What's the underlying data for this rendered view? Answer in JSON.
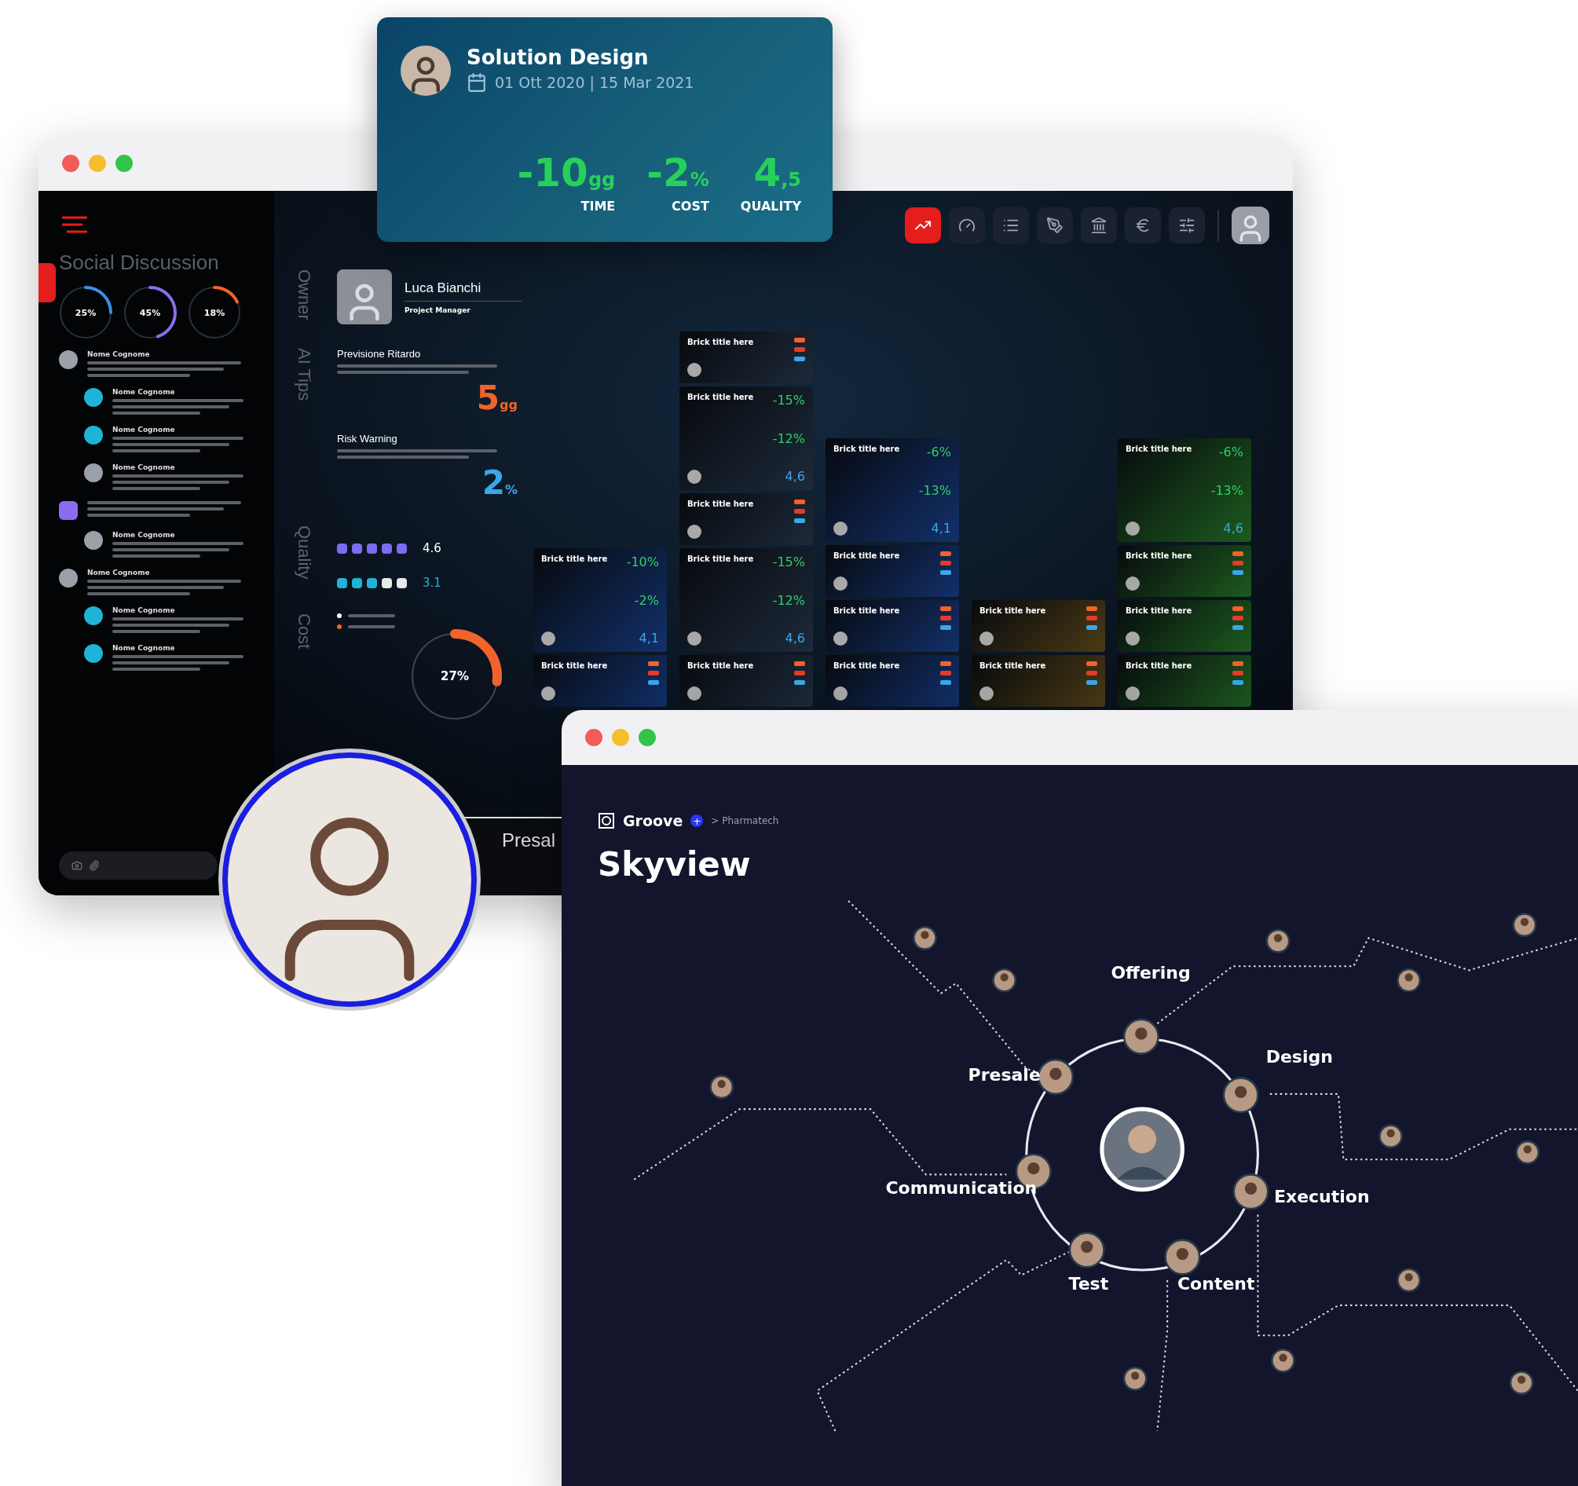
{
  "floating_card": {
    "title": "Solution Design",
    "dates": "01 Ott 2020 | 15 Mar 2021",
    "metrics": [
      {
        "value": "-10",
        "unit": "gg",
        "label": "TIME"
      },
      {
        "value": "-2",
        "unit": "%",
        "label": "COST"
      },
      {
        "value": "4",
        "unit": ",5",
        "label": "QUALITY"
      }
    ]
  },
  "dashboard": {
    "sidebar": {
      "title": "Social Discussion",
      "gauges": [
        {
          "reading": "25%",
          "level": 0.25,
          "color": "#3b8ee8"
        },
        {
          "reading": "45%",
          "level": 0.45,
          "color": "#8b6cf0"
        },
        {
          "reading": "18%",
          "level": 0.18,
          "color": "#f0632a"
        }
      ],
      "comments": [
        {
          "author": "Nome Cognome",
          "color": "#9aa0a8",
          "children": [
            {
              "author": "Nome Cognome",
              "color": "#1fb3d6"
            },
            {
              "author": "Nome Cognome",
              "color": "#1fb3d6"
            },
            {
              "author": "Nome Cognome",
              "color": "#9aa0a8"
            }
          ]
        },
        {
          "color": "#8b6cf0",
          "children": [
            {
              "author": "Nome Cognome",
              "color": "#9aa0a8"
            }
          ]
        },
        {
          "author": "Nome Cognome",
          "color": "#9aa0a8",
          "children": [
            {
              "author": "Nome Cognome",
              "color": "#1fb3d6"
            },
            {
              "author": "Nome Cognome",
              "color": "#1fb3d6"
            }
          ]
        }
      ]
    },
    "sections": {
      "owner_label": "Owner",
      "owner_name": "Luca Bianchi",
      "owner_role": "Project Manager",
      "tips_label": "AI Tips",
      "tips": [
        {
          "title": "Previsione Ritardo",
          "value": "5",
          "unit": "gg",
          "color": "#f0632a"
        },
        {
          "title": "Risk Warning",
          "value": "2",
          "unit": "%",
          "color": "#3ba7e8"
        }
      ],
      "quality_label": "Quality",
      "ratings": [
        {
          "stars": 5,
          "reading": "4.6",
          "color": "#7b6cf0"
        },
        {
          "stars": 3,
          "reading": "3.1",
          "color": "#1fb3d6"
        }
      ],
      "cost_label": "Cost",
      "cost_gauge": {
        "reading": "27%",
        "level": 0.27
      }
    },
    "toolbar": [
      {
        "selected": true
      },
      {
        "selected": false
      },
      {
        "selected": false
      },
      {
        "selected": false
      },
      {
        "selected": false
      },
      {
        "selected": false
      },
      {
        "selected": false
      }
    ],
    "tile_columns": [
      [
        {
          "kind": "large",
          "color": "#12306a",
          "title": "Brick title here",
          "metrics": [
            "-10%",
            "-2%",
            "4,1"
          ]
        },
        {
          "kind": "small",
          "color": "#12306a",
          "title": "Brick title here"
        }
      ],
      [
        {
          "kind": "small",
          "color": "#1d2a3a",
          "title": "Brick title here"
        },
        {
          "kind": "large",
          "color": "#1d2a3a",
          "title": "Brick title here",
          "metrics": [
            "-15%",
            "-12%",
            "4,6"
          ]
        },
        {
          "kind": "small",
          "color": "#1d2a3a",
          "title": "Brick title here"
        },
        {
          "kind": "large",
          "color": "#1d2a3a",
          "title": "Brick title here",
          "metrics": [
            "-15%",
            "-12%",
            "4,6"
          ]
        },
        {
          "kind": "small",
          "color": "#1d2a3a",
          "title": "Brick title here"
        }
      ],
      [
        {
          "kind": "large",
          "color": "#12306a",
          "title": "Brick title here",
          "metrics": [
            "-6%",
            "-13%",
            "4,1"
          ]
        },
        {
          "kind": "small",
          "color": "#12306a",
          "title": "Brick title here"
        },
        {
          "kind": "small",
          "color": "#12306a",
          "title": "Brick title here"
        },
        {
          "kind": "small",
          "color": "#12306a",
          "title": "Brick title here"
        }
      ],
      [
        {
          "kind": "small",
          "color": "#4a3a14",
          "title": "Brick title here"
        },
        {
          "kind": "small",
          "color": "#4a3a14",
          "title": "Brick title here"
        }
      ],
      [
        {
          "kind": "large",
          "color": "#1c5a1e",
          "title": "Brick title here",
          "metrics": [
            "-6%",
            "-13%",
            "4,6"
          ]
        },
        {
          "kind": "small",
          "color": "#1c5a1e",
          "title": "Brick title here"
        },
        {
          "kind": "small",
          "color": "#1c5a1e",
          "title": "Brick title here"
        },
        {
          "kind": "small",
          "color": "#1c5a1e",
          "title": "Brick title here"
        }
      ]
    ],
    "bottom_strip": {
      "title": "Presal"
    }
  },
  "skyview": {
    "brand": "Groove",
    "badge": "+",
    "breadcrumb": "> Pharmatech",
    "title": "Skyview",
    "stages": [
      {
        "label": "Offering"
      },
      {
        "label": "Presale"
      },
      {
        "label": "Design"
      },
      {
        "label": "Communication"
      },
      {
        "label": "Execution"
      },
      {
        "label": "Test"
      },
      {
        "label": "Content"
      }
    ]
  }
}
